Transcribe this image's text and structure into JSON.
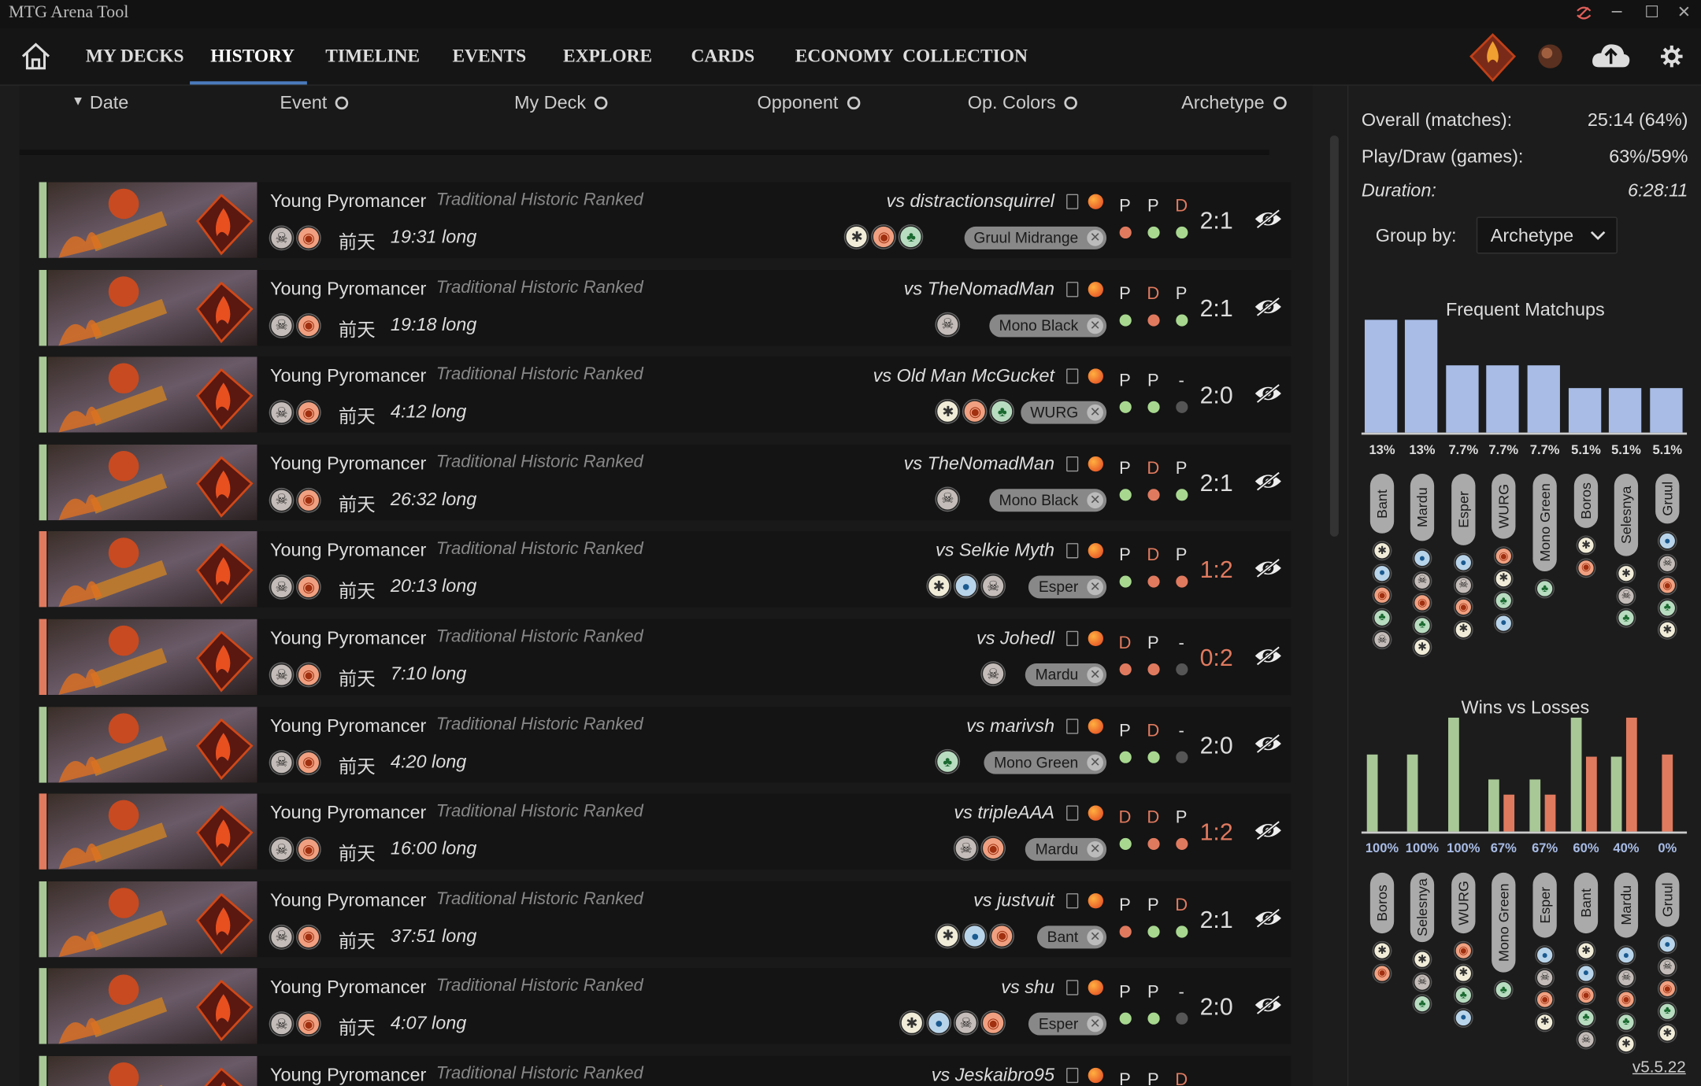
{
  "window": {
    "title": "MTG Arena Tool"
  },
  "nav": {
    "items": [
      "MY DECKS",
      "HISTORY",
      "TIMELINE",
      "EVENTS",
      "EXPLORE",
      "CARDS",
      "ECONOMY",
      "COLLECTION"
    ],
    "active": "HISTORY"
  },
  "table_header": {
    "date": "Date",
    "event": "Event",
    "my_deck": "My Deck",
    "opponent": "Opponent",
    "op_colors": "Op. Colors",
    "archetype": "Archetype"
  },
  "colors": {
    "win_accent": "#a8c896",
    "loss_accent": "#e07a5f",
    "win_score": "#dddddd",
    "loss_score": "#e07a5f",
    "bar_blue": "#a8bce6",
    "bar_green": "#a8c896",
    "bar_orange": "#e07a5f",
    "dot_green": "#a8d890",
    "dot_red": "#e07a5f",
    "dot_gray": "#555555"
  },
  "matches": [
    {
      "result": "win",
      "deck": "Young Pyromancer",
      "event": "Traditional Historic Ranked",
      "deck_colors": [
        "B",
        "R"
      ],
      "when": "前天",
      "duration": "19:31 long",
      "opponent": "vs distractionsquirrel",
      "opp_colors": [
        "W",
        "R",
        "G"
      ],
      "archetype": "Gruul Midrange",
      "games": [
        {
          "pd": "P",
          "res": "L"
        },
        {
          "pd": "P",
          "res": "W"
        },
        {
          "pd": "D",
          "res": "W"
        }
      ],
      "score": "2:1"
    },
    {
      "result": "win",
      "deck": "Young Pyromancer",
      "event": "Traditional Historic Ranked",
      "deck_colors": [
        "B",
        "R"
      ],
      "when": "前天",
      "duration": "19:18 long",
      "opponent": "vs TheNomadMan",
      "opp_colors": [
        "B"
      ],
      "archetype": "Mono Black",
      "games": [
        {
          "pd": "P",
          "res": "W"
        },
        {
          "pd": "D",
          "res": "L"
        },
        {
          "pd": "P",
          "res": "W"
        }
      ],
      "score": "2:1"
    },
    {
      "result": "win",
      "deck": "Young Pyromancer",
      "event": "Traditional Historic Ranked",
      "deck_colors": [
        "B",
        "R"
      ],
      "when": "前天",
      "duration": "4:12 long",
      "opponent": "vs Old Man McGucket",
      "opp_colors": [
        "W",
        "R",
        "G"
      ],
      "archetype": "WURG",
      "games": [
        {
          "pd": "P",
          "res": "W"
        },
        {
          "pd": "P",
          "res": "W"
        },
        {
          "pd": "-",
          "res": "N"
        }
      ],
      "score": "2:0"
    },
    {
      "result": "win",
      "deck": "Young Pyromancer",
      "event": "Traditional Historic Ranked",
      "deck_colors": [
        "B",
        "R"
      ],
      "when": "前天",
      "duration": "26:32 long",
      "opponent": "vs TheNomadMan",
      "opp_colors": [
        "B"
      ],
      "archetype": "Mono Black",
      "games": [
        {
          "pd": "P",
          "res": "W"
        },
        {
          "pd": "D",
          "res": "L"
        },
        {
          "pd": "P",
          "res": "W"
        }
      ],
      "score": "2:1"
    },
    {
      "result": "loss",
      "deck": "Young Pyromancer",
      "event": "Traditional Historic Ranked",
      "deck_colors": [
        "B",
        "R"
      ],
      "when": "前天",
      "duration": "20:13 long",
      "opponent": "vs Selkie Myth",
      "opp_colors": [
        "W",
        "U",
        "B"
      ],
      "archetype": "Esper",
      "games": [
        {
          "pd": "P",
          "res": "W"
        },
        {
          "pd": "D",
          "res": "L"
        },
        {
          "pd": "P",
          "res": "L"
        }
      ],
      "score": "1:2"
    },
    {
      "result": "loss",
      "deck": "Young Pyromancer",
      "event": "Traditional Historic Ranked",
      "deck_colors": [
        "B",
        "R"
      ],
      "when": "前天",
      "duration": "7:10 long",
      "opponent": "vs Johedl",
      "opp_colors": [
        "B"
      ],
      "archetype": "Mardu",
      "games": [
        {
          "pd": "D",
          "res": "L"
        },
        {
          "pd": "P",
          "res": "L"
        },
        {
          "pd": "-",
          "res": "N"
        }
      ],
      "score": "0:2"
    },
    {
      "result": "win",
      "deck": "Young Pyromancer",
      "event": "Traditional Historic Ranked",
      "deck_colors": [
        "B",
        "R"
      ],
      "when": "前天",
      "duration": "4:20 long",
      "opponent": "vs marivsh",
      "opp_colors": [
        "G"
      ],
      "archetype": "Mono Green",
      "games": [
        {
          "pd": "P",
          "res": "W"
        },
        {
          "pd": "D",
          "res": "W"
        },
        {
          "pd": "-",
          "res": "N"
        }
      ],
      "score": "2:0"
    },
    {
      "result": "loss",
      "deck": "Young Pyromancer",
      "event": "Traditional Historic Ranked",
      "deck_colors": [
        "B",
        "R"
      ],
      "when": "前天",
      "duration": "16:00 long",
      "opponent": "vs tripleAAA",
      "opp_colors": [
        "B",
        "R"
      ],
      "archetype": "Mardu",
      "games": [
        {
          "pd": "D",
          "res": "W"
        },
        {
          "pd": "D",
          "res": "L"
        },
        {
          "pd": "P",
          "res": "L"
        }
      ],
      "score": "1:2"
    },
    {
      "result": "win",
      "deck": "Young Pyromancer",
      "event": "Traditional Historic Ranked",
      "deck_colors": [
        "B",
        "R"
      ],
      "when": "前天",
      "duration": "37:51 long",
      "opponent": "vs justvuit",
      "opp_colors": [
        "W",
        "U",
        "R"
      ],
      "archetype": "Bant",
      "games": [
        {
          "pd": "P",
          "res": "L"
        },
        {
          "pd": "P",
          "res": "W"
        },
        {
          "pd": "D",
          "res": "W"
        }
      ],
      "score": "2:1"
    },
    {
      "result": "win",
      "deck": "Young Pyromancer",
      "event": "Traditional Historic Ranked",
      "deck_colors": [
        "B",
        "R"
      ],
      "when": "前天",
      "duration": "4:07 long",
      "opponent": "vs shu",
      "opp_colors": [
        "W",
        "U",
        "B",
        "R"
      ],
      "archetype": "Esper",
      "games": [
        {
          "pd": "P",
          "res": "W"
        },
        {
          "pd": "P",
          "res": "W"
        },
        {
          "pd": "-",
          "res": "N"
        }
      ],
      "score": "2:0"
    },
    {
      "result": "win",
      "deck": "Young Pyromancer",
      "event": "Traditional Historic Ranked",
      "deck_colors": [
        "B",
        "R"
      ],
      "when": "",
      "duration": "",
      "opponent": "vs Jeskaibro95",
      "opp_colors": [],
      "archetype": "",
      "games": [
        {
          "pd": "P",
          "res": "N"
        },
        {
          "pd": "P",
          "res": "N"
        },
        {
          "pd": "D",
          "res": "N"
        }
      ],
      "score": ""
    }
  ],
  "stats": {
    "overall_label": "Overall (matches):",
    "overall_value": "25:14 (64%)",
    "playdraw_label": "Play/Draw (games):",
    "playdraw_value": "63%/59%",
    "duration_label": "Duration:",
    "duration_value": "6:28:11",
    "group_by_label": "Group by:",
    "group_by_value": "Archetype"
  },
  "chart_data": [
    {
      "type": "bar",
      "title": "Frequent Matchups",
      "categories": [
        "Bant",
        "Mardu",
        "Esper",
        "WURG",
        "Mono Green",
        "Boros",
        "Selesnya",
        "Gruul"
      ],
      "values": [
        13,
        13,
        7.7,
        7.7,
        7.7,
        5.1,
        5.1,
        5.1
      ],
      "labels": [
        "13%",
        "13%",
        "7.7%",
        "7.7%",
        "7.7%",
        "5.1%",
        "5.1%",
        "5.1%"
      ],
      "colors": [
        [
          "W",
          "U",
          "R",
          "G",
          "B"
        ],
        [
          "U",
          "B",
          "R",
          "G",
          "W"
        ],
        [
          "U",
          "B",
          "R",
          "W"
        ],
        [
          "R",
          "W",
          "G",
          "U"
        ],
        [
          "G"
        ],
        [
          "W",
          "R"
        ],
        [
          "W",
          "B",
          "G"
        ],
        [
          "U",
          "B",
          "R",
          "G",
          "W"
        ]
      ]
    },
    {
      "type": "bar",
      "title": "Wins vs Losses",
      "categories": [
        "Boros",
        "Selesnya",
        "WURG",
        "Mono Green",
        "Esper",
        "Bant",
        "Mardu",
        "Gruul"
      ],
      "series": [
        {
          "values": [
            1,
            1,
            1,
            0.67,
            0.67,
            0.6,
            0.4,
            0
          ]
        }
      ],
      "wins": [
        1,
        1,
        1,
        0.67,
        0.67,
        0.6,
        0.4,
        0
      ],
      "labels": [
        "100%",
        "100%",
        "100%",
        "67%",
        "67%",
        "60%",
        "40%",
        "0%"
      ],
      "colors": [
        [
          "W",
          "R"
        ],
        [
          "W",
          "B",
          "G"
        ],
        [
          "R",
          "W",
          "G",
          "U"
        ],
        [
          "G"
        ],
        [
          "U",
          "B",
          "R",
          "W"
        ],
        [
          "W",
          "U",
          "R",
          "G",
          "B"
        ],
        [
          "U",
          "B",
          "R",
          "G",
          "W"
        ],
        [
          "U",
          "B",
          "R",
          "G",
          "W"
        ]
      ]
    }
  ],
  "version": "v5.5.22"
}
